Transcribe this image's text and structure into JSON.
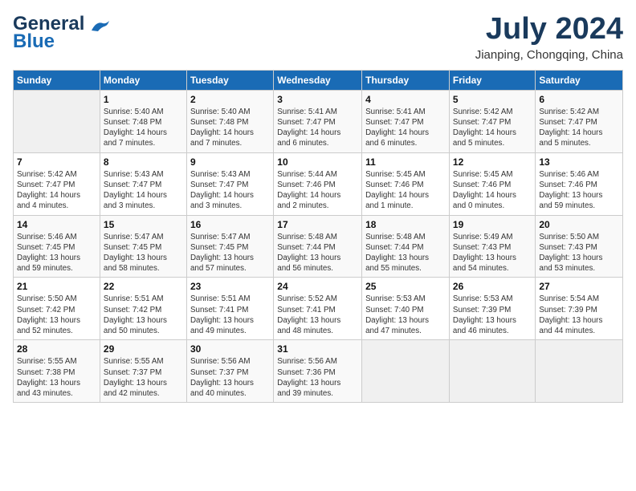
{
  "header": {
    "logo_line1": "General",
    "logo_line2": "Blue",
    "month": "July 2024",
    "location": "Jianping, Chongqing, China"
  },
  "weekdays": [
    "Sunday",
    "Monday",
    "Tuesday",
    "Wednesday",
    "Thursday",
    "Friday",
    "Saturday"
  ],
  "weeks": [
    [
      {
        "day": "",
        "info": ""
      },
      {
        "day": "1",
        "info": "Sunrise: 5:40 AM\nSunset: 7:48 PM\nDaylight: 14 hours\nand 7 minutes."
      },
      {
        "day": "2",
        "info": "Sunrise: 5:40 AM\nSunset: 7:48 PM\nDaylight: 14 hours\nand 7 minutes."
      },
      {
        "day": "3",
        "info": "Sunrise: 5:41 AM\nSunset: 7:47 PM\nDaylight: 14 hours\nand 6 minutes."
      },
      {
        "day": "4",
        "info": "Sunrise: 5:41 AM\nSunset: 7:47 PM\nDaylight: 14 hours\nand 6 minutes."
      },
      {
        "day": "5",
        "info": "Sunrise: 5:42 AM\nSunset: 7:47 PM\nDaylight: 14 hours\nand 5 minutes."
      },
      {
        "day": "6",
        "info": "Sunrise: 5:42 AM\nSunset: 7:47 PM\nDaylight: 14 hours\nand 5 minutes."
      }
    ],
    [
      {
        "day": "7",
        "info": "Sunrise: 5:42 AM\nSunset: 7:47 PM\nDaylight: 14 hours\nand 4 minutes."
      },
      {
        "day": "8",
        "info": "Sunrise: 5:43 AM\nSunset: 7:47 PM\nDaylight: 14 hours\nand 3 minutes."
      },
      {
        "day": "9",
        "info": "Sunrise: 5:43 AM\nSunset: 7:47 PM\nDaylight: 14 hours\nand 3 minutes."
      },
      {
        "day": "10",
        "info": "Sunrise: 5:44 AM\nSunset: 7:46 PM\nDaylight: 14 hours\nand 2 minutes."
      },
      {
        "day": "11",
        "info": "Sunrise: 5:45 AM\nSunset: 7:46 PM\nDaylight: 14 hours\nand 1 minute."
      },
      {
        "day": "12",
        "info": "Sunrise: 5:45 AM\nSunset: 7:46 PM\nDaylight: 14 hours\nand 0 minutes."
      },
      {
        "day": "13",
        "info": "Sunrise: 5:46 AM\nSunset: 7:46 PM\nDaylight: 13 hours\nand 59 minutes."
      }
    ],
    [
      {
        "day": "14",
        "info": "Sunrise: 5:46 AM\nSunset: 7:45 PM\nDaylight: 13 hours\nand 59 minutes."
      },
      {
        "day": "15",
        "info": "Sunrise: 5:47 AM\nSunset: 7:45 PM\nDaylight: 13 hours\nand 58 minutes."
      },
      {
        "day": "16",
        "info": "Sunrise: 5:47 AM\nSunset: 7:45 PM\nDaylight: 13 hours\nand 57 minutes."
      },
      {
        "day": "17",
        "info": "Sunrise: 5:48 AM\nSunset: 7:44 PM\nDaylight: 13 hours\nand 56 minutes."
      },
      {
        "day": "18",
        "info": "Sunrise: 5:48 AM\nSunset: 7:44 PM\nDaylight: 13 hours\nand 55 minutes."
      },
      {
        "day": "19",
        "info": "Sunrise: 5:49 AM\nSunset: 7:43 PM\nDaylight: 13 hours\nand 54 minutes."
      },
      {
        "day": "20",
        "info": "Sunrise: 5:50 AM\nSunset: 7:43 PM\nDaylight: 13 hours\nand 53 minutes."
      }
    ],
    [
      {
        "day": "21",
        "info": "Sunrise: 5:50 AM\nSunset: 7:42 PM\nDaylight: 13 hours\nand 52 minutes."
      },
      {
        "day": "22",
        "info": "Sunrise: 5:51 AM\nSunset: 7:42 PM\nDaylight: 13 hours\nand 50 minutes."
      },
      {
        "day": "23",
        "info": "Sunrise: 5:51 AM\nSunset: 7:41 PM\nDaylight: 13 hours\nand 49 minutes."
      },
      {
        "day": "24",
        "info": "Sunrise: 5:52 AM\nSunset: 7:41 PM\nDaylight: 13 hours\nand 48 minutes."
      },
      {
        "day": "25",
        "info": "Sunrise: 5:53 AM\nSunset: 7:40 PM\nDaylight: 13 hours\nand 47 minutes."
      },
      {
        "day": "26",
        "info": "Sunrise: 5:53 AM\nSunset: 7:39 PM\nDaylight: 13 hours\nand 46 minutes."
      },
      {
        "day": "27",
        "info": "Sunrise: 5:54 AM\nSunset: 7:39 PM\nDaylight: 13 hours\nand 44 minutes."
      }
    ],
    [
      {
        "day": "28",
        "info": "Sunrise: 5:55 AM\nSunset: 7:38 PM\nDaylight: 13 hours\nand 43 minutes."
      },
      {
        "day": "29",
        "info": "Sunrise: 5:55 AM\nSunset: 7:37 PM\nDaylight: 13 hours\nand 42 minutes."
      },
      {
        "day": "30",
        "info": "Sunrise: 5:56 AM\nSunset: 7:37 PM\nDaylight: 13 hours\nand 40 minutes."
      },
      {
        "day": "31",
        "info": "Sunrise: 5:56 AM\nSunset: 7:36 PM\nDaylight: 13 hours\nand 39 minutes."
      },
      {
        "day": "",
        "info": ""
      },
      {
        "day": "",
        "info": ""
      },
      {
        "day": "",
        "info": ""
      }
    ]
  ]
}
